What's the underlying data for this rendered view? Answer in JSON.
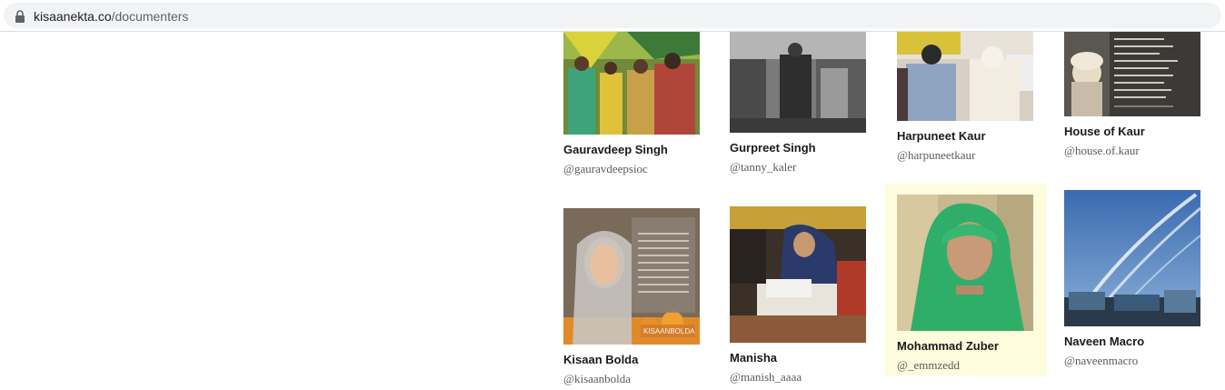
{
  "browser": {
    "url_host": "kisaanekta.co",
    "url_path": "/documenters"
  },
  "documenters": [
    {
      "name": "Gauravdeep Singh",
      "handle": "@gauravdeepsioc"
    },
    {
      "name": "Gurpreet Singh",
      "handle": "@tanny_kaler"
    },
    {
      "name": "Harpuneet Kaur",
      "handle": "@harpuneetkaur"
    },
    {
      "name": "House of Kaur",
      "handle": "@house.of.kaur"
    },
    {
      "name": "Kisaan Bolda",
      "handle": "@kisaanbolda"
    },
    {
      "name": "Manisha",
      "handle": "@manish_aaaa"
    },
    {
      "name": "Mohammad Zuber",
      "handle": "@_emmzedd"
    },
    {
      "name": "Naveen Macro",
      "handle": "@naveenmacro"
    }
  ],
  "image_overlays": {
    "kisaan_bolda_watermark": "KISAANBOLDA"
  },
  "colors": {
    "hover_highlight": "#fdfcdc",
    "name_text": "#1a1a1a",
    "handle_text": "#5a5a5a"
  }
}
